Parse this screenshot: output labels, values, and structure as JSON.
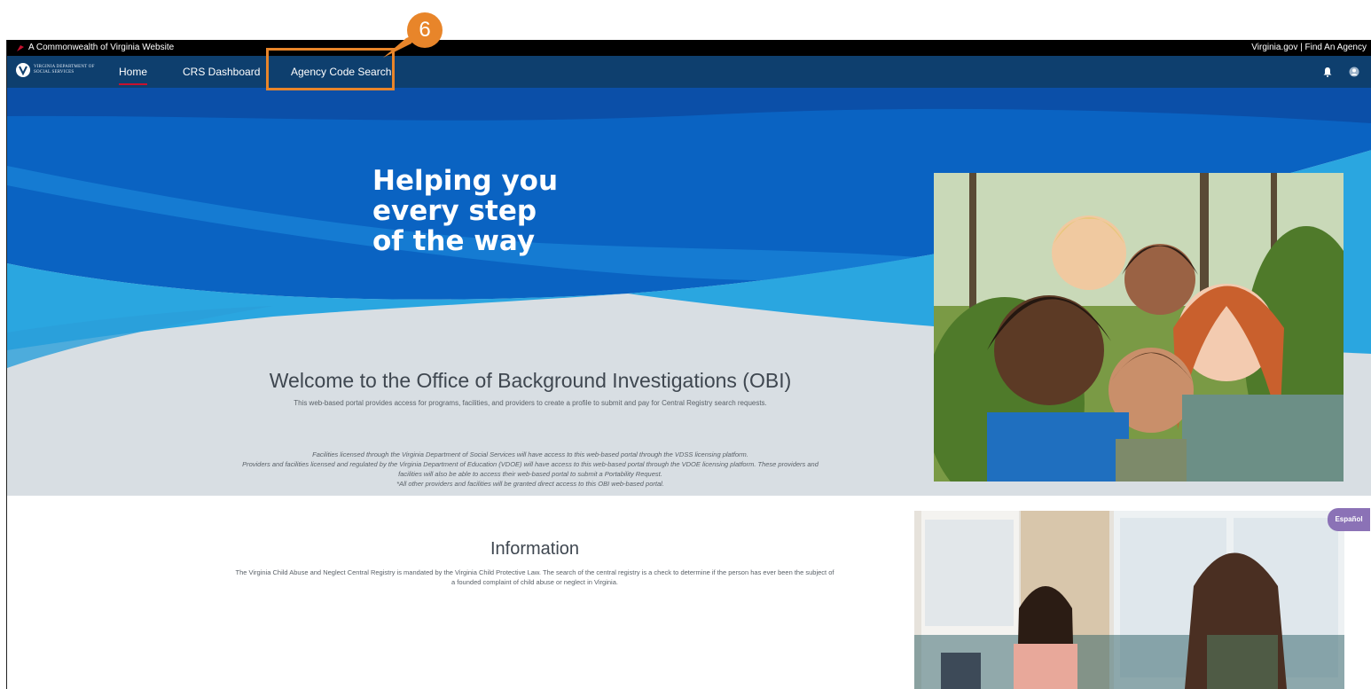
{
  "gov_bar": {
    "left_text": "A Commonwealth of Virginia Website",
    "right_text": "Virginia.gov | Find An Agency"
  },
  "logo": {
    "line1": "VIRGINIA DEPARTMENT OF",
    "line2": "SOCIAL SERVICES"
  },
  "nav": {
    "items": [
      {
        "label": "Home"
      },
      {
        "label": "CRS Dashboard"
      },
      {
        "label": "Agency Code Search"
      }
    ]
  },
  "hero": {
    "tagline": [
      "Helping you",
      "every step",
      "of the way"
    ],
    "welcome_title": "Welcome to the Office of Background Investigations (OBI)",
    "welcome_subtitle": "This web-based portal provides access for programs, facilities, and providers to create a profile to submit and pay for Central Registry search requests.",
    "notes": [
      "Facilities licensed through the Virginia Department of Social Services will have access to this web-based portal through the VDSS licensing platform.",
      "Providers and facilities licensed and regulated by the Virginia Department of Education (VDOE) will have access to this web-based portal through the VDOE licensing platform. These providers and facilities will also be able to access their web-based portal to submit a Portability Request.",
      "*All other providers and facilities will be granted direct access to this OBI web-based portal."
    ]
  },
  "information": {
    "title": "Information",
    "text": "The Virginia Child Abuse and Neglect Central Registry is mandated by the Virginia Child Protective Law. The search of the central registry is a check to determine if the person has ever been the subject of a founded complaint of child abuse or neglect in Virginia."
  },
  "language_button": "Español",
  "annotation": {
    "step_number": "6",
    "color": "#e8852a"
  },
  "colors": {
    "nav_bg": "#0e3f6e",
    "hero_blue": "#0a63c2",
    "hero_light": "#2aa6e0",
    "accent_red": "#c8102e"
  },
  "icons": [
    "virginia-cardinal-icon",
    "vdss-logo-icon",
    "bell-icon",
    "user-icon"
  ]
}
